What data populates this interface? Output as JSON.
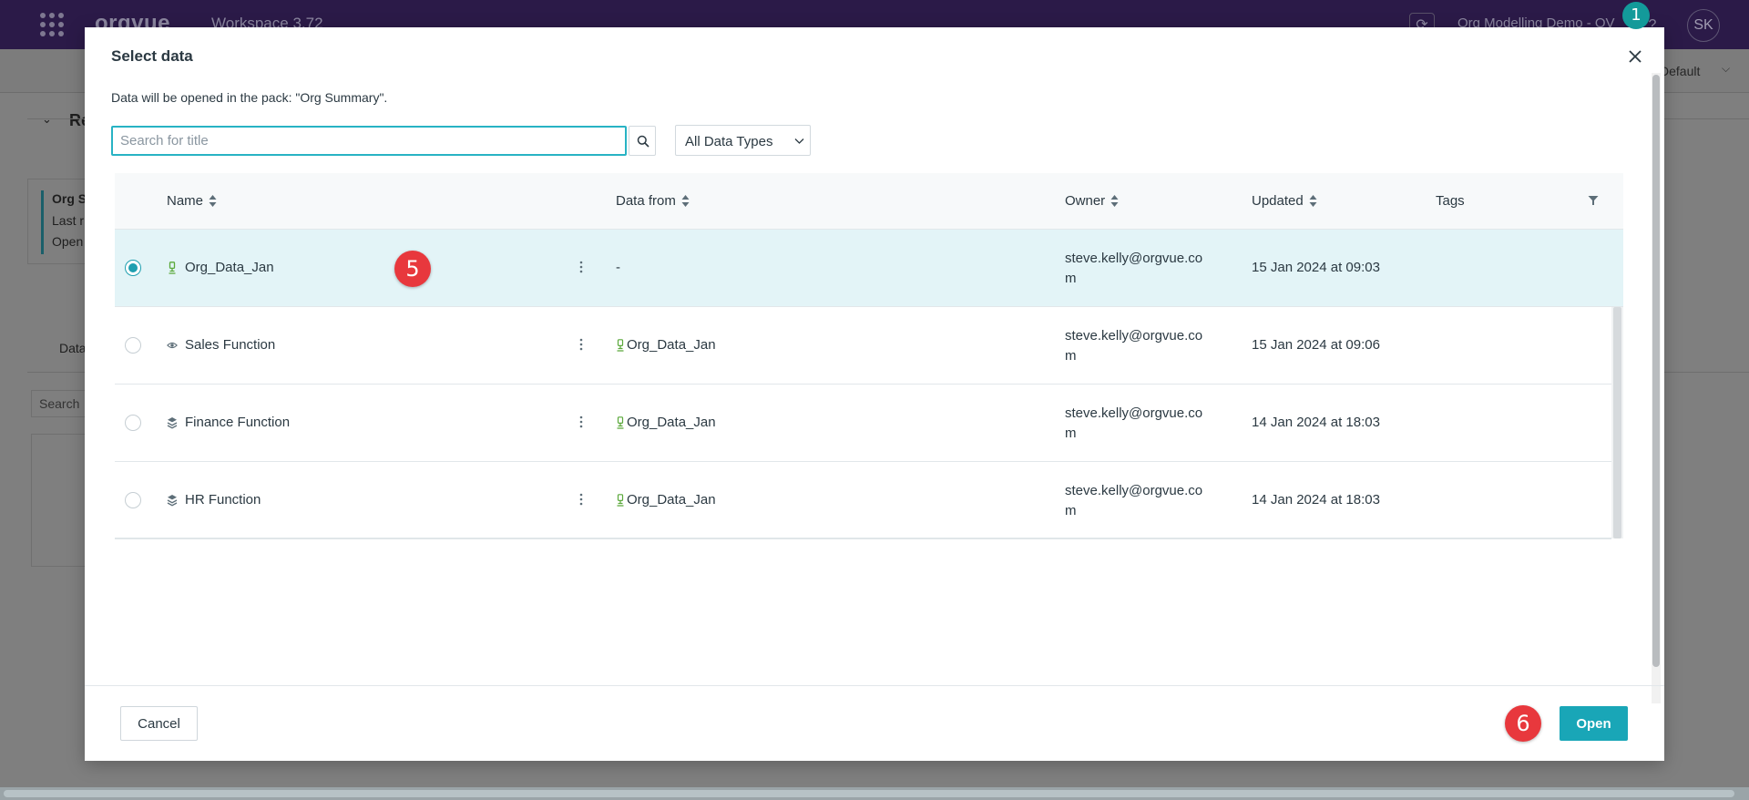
{
  "app": {
    "brand": "orgvue",
    "workspace": "Workspace 3.72",
    "project": "Org Modelling Demo - OV",
    "avatar_initials": "SK",
    "help": "?",
    "view_label": "Default",
    "bg_section": "Re",
    "bg_card_title": "Org S",
    "bg_card_line2": "Last r",
    "bg_card_line3": "Open",
    "bg_tab": "Data",
    "bg_search": "Search"
  },
  "badges": {
    "notification": "1",
    "step_5": "5",
    "step_6": "6"
  },
  "modal": {
    "title": "Select data",
    "description": "Data will be opened in the pack: \"Org Summary\".",
    "search": {
      "placeholder": "Search for title",
      "value": ""
    },
    "type_filter": {
      "selected": "All Data Types"
    },
    "table": {
      "columns": {
        "name": "Name",
        "data_from": "Data from",
        "owner": "Owner",
        "updated": "Updated",
        "tags": "Tags"
      },
      "rows": [
        {
          "name": "Org_Data_Jan",
          "icon": "dataset-icon",
          "data_from": "-",
          "owner": "steve.kelly@orgvue.com",
          "updated": "15 Jan 2024 at 09:03",
          "tags": "",
          "selected": true
        },
        {
          "name": "Sales Function",
          "icon": "view-icon",
          "data_from": "Org_Data_Jan",
          "owner": "steve.kelly@orgvue.com",
          "updated": "15 Jan 2024 at 09:06",
          "tags": "",
          "selected": false
        },
        {
          "name": "Finance Function",
          "icon": "layers-icon",
          "data_from": "Org_Data_Jan",
          "owner": "steve.kelly@orgvue.com",
          "updated": "14 Jan 2024 at 18:03",
          "tags": "",
          "selected": false
        },
        {
          "name": "HR Function",
          "icon": "layers-icon",
          "data_from": "Org_Data_Jan",
          "owner": "steve.kelly@orgvue.com",
          "updated": "14 Jan 2024 at 18:03",
          "tags": "",
          "selected": false
        }
      ]
    },
    "footer": {
      "cancel_label": "Cancel",
      "open_label": "Open"
    }
  },
  "colors": {
    "header_bg": "#2b1a48",
    "accent": "#19a6b7",
    "selected_row": "#e3f4f7",
    "step_badge": "#e8383d",
    "notification_badge": "#139a9a",
    "dataset_icon": "#5aa83a"
  }
}
